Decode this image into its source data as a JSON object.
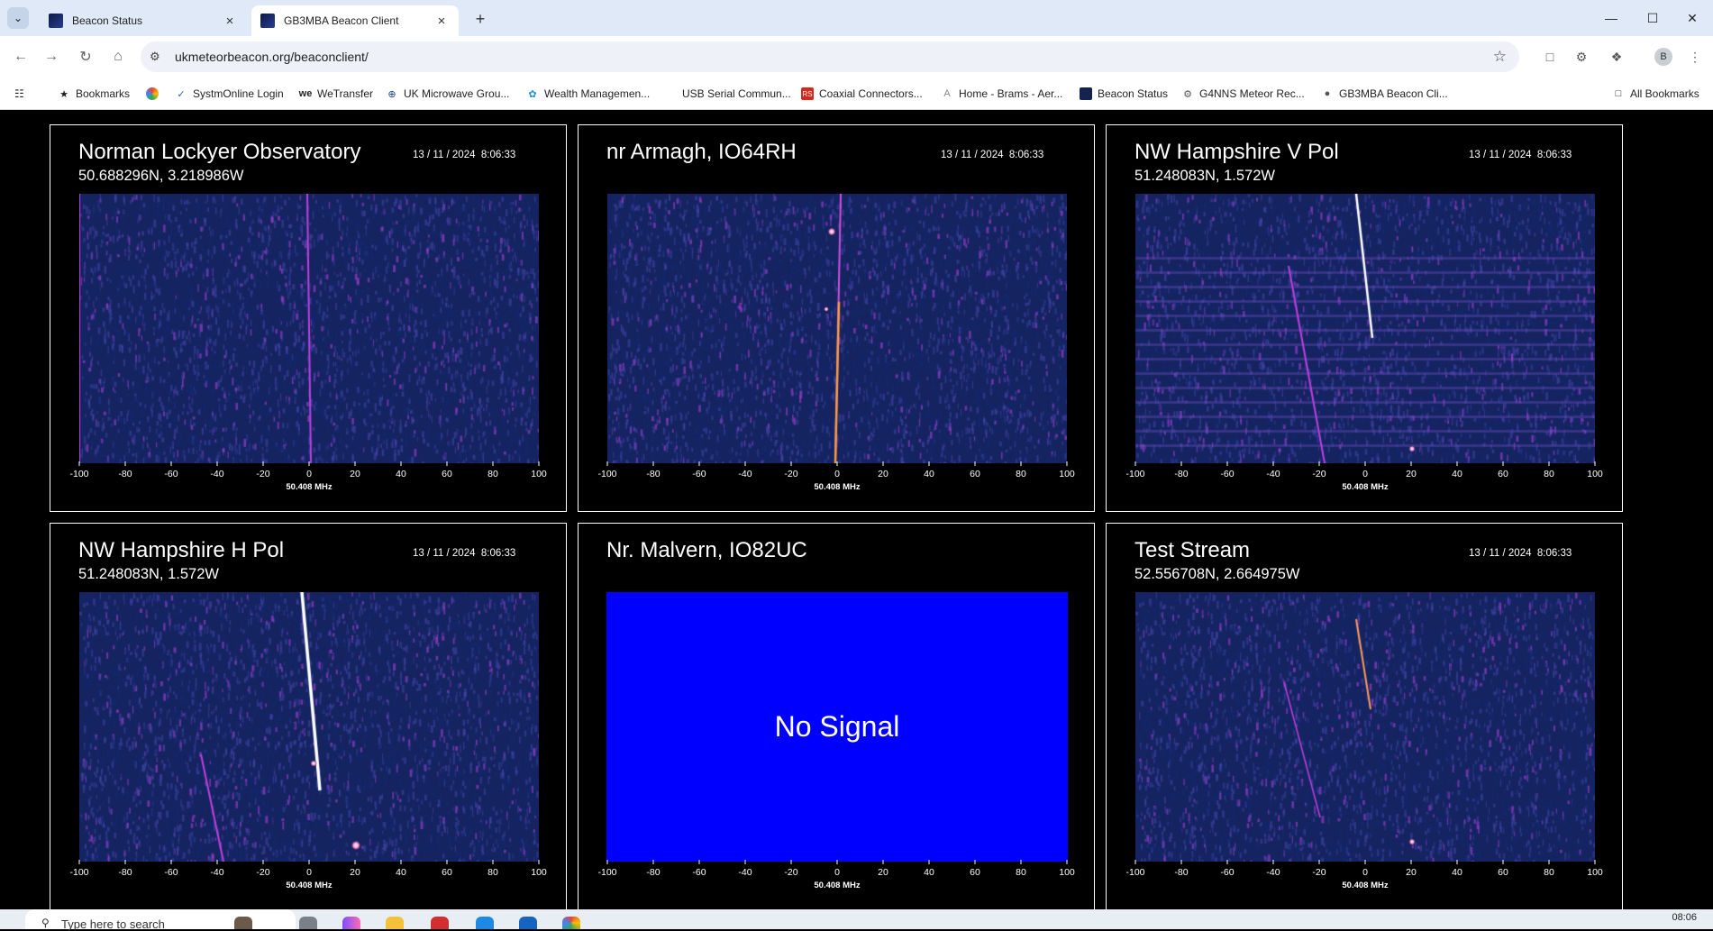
{
  "browser": {
    "tabs": [
      {
        "title": "Beacon Status",
        "active": false
      },
      {
        "title": "GB3MBA Beacon Client",
        "active": true
      }
    ],
    "url": "ukmeteorbeacon.org/beaconclient/",
    "bookmarks": [
      {
        "label": "Bookmarks",
        "icon": "star-icon"
      },
      {
        "label": "",
        "icon": "chrome-store-icon"
      },
      {
        "label": "SystmOnline Login",
        "icon": "systmonline-icon"
      },
      {
        "label": "WeTransfer",
        "icon": "wetransfer-icon"
      },
      {
        "label": "UK Microwave Grou...",
        "icon": "microwave-group-icon"
      },
      {
        "label": "Wealth Managemen...",
        "icon": "wealth-icon"
      },
      {
        "label": "USB Serial Commun...",
        "icon": ""
      },
      {
        "label": "Coaxial Connectors...",
        "icon": "rs-icon"
      },
      {
        "label": "Home - Brams - Aer...",
        "icon": "brams-icon"
      },
      {
        "label": "Beacon Status",
        "icon": "beacon-icon"
      },
      {
        "label": "G4NNS Meteor Rec...",
        "icon": "g4nns-icon"
      },
      {
        "label": "GB3MBA Beacon Cli...",
        "icon": "globe-icon"
      }
    ],
    "all_bookmarks": "All Bookmarks",
    "avatar_initial": "B"
  },
  "panels": [
    {
      "name": "Norman Lockyer Observatory",
      "datetime": "13 / 11 / 2024  8:06:33",
      "coords": "50.688296N, 3.218986W",
      "signal": true
    },
    {
      "name": "nr Armagh, IO64RH",
      "datetime": "13 / 11 / 2024  8:06:33",
      "coords": "",
      "signal": true
    },
    {
      "name": "NW Hampshire V Pol",
      "datetime": "13 / 11 / 2024  8:06:33",
      "coords": "51.248083N, 1.572W",
      "signal": true
    },
    {
      "name": "NW Hampshire H Pol",
      "datetime": "13 / 11 / 2024  8:06:33",
      "coords": "51.248083N, 1.572W",
      "signal": true
    },
    {
      "name": "Nr. Malvern, IO82UC",
      "datetime": "",
      "coords": "",
      "signal": false,
      "no_signal_text": "No Signal"
    },
    {
      "name": "Test Stream",
      "datetime": "13 / 11 / 2024  8:06:33",
      "coords": "52.556708N, 2.664975W",
      "signal": true
    }
  ],
  "axis": {
    "ticks": [
      "-100",
      "-80",
      "-60",
      "-40",
      "-20",
      "0",
      "20",
      "40",
      "60",
      "80",
      "100"
    ],
    "center_label": "50.408 MHz"
  },
  "taskbar": {
    "search_placeholder": "Type here to search",
    "clock": "08:06"
  },
  "colors": {
    "tab_strip": "#dfe9f7",
    "no_signal_blue": "#0000ff",
    "spectrogram_bg": "#1a2a6b",
    "spectrogram_trace": "#ff66ff"
  }
}
